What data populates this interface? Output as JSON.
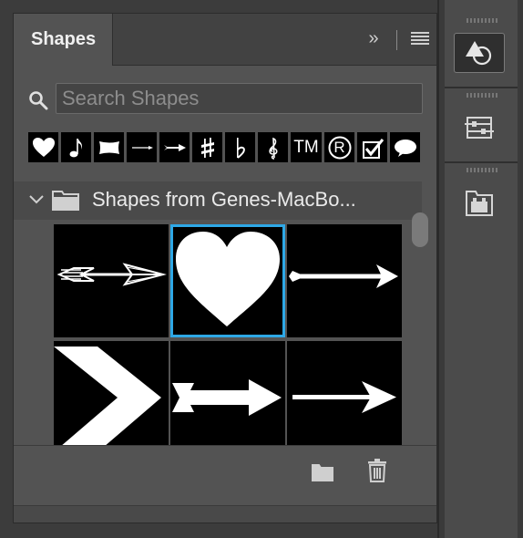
{
  "panel": {
    "tab_label": "Shapes",
    "collapse_glyph": "»",
    "search": {
      "placeholder": "Search Shapes",
      "value": ""
    },
    "recent_shapes": [
      {
        "name": "heart"
      },
      {
        "name": "eighth-note"
      },
      {
        "name": "banner"
      },
      {
        "name": "thin-arrow"
      },
      {
        "name": "tailed-arrow"
      },
      {
        "name": "sharp"
      },
      {
        "name": "flat"
      },
      {
        "name": "treble-clef"
      },
      {
        "name": "trademark",
        "text": "TM"
      },
      {
        "name": "registered",
        "text": "R"
      },
      {
        "name": "checkbox"
      },
      {
        "name": "speech-bubble"
      }
    ],
    "group": {
      "title": "Shapes from Genes-MacBo..."
    },
    "shapes_grid": [
      {
        "name": "feathered-arrow",
        "selected": false
      },
      {
        "name": "heart",
        "selected": true
      },
      {
        "name": "dart-arrow",
        "selected": false
      },
      {
        "name": "chevron",
        "selected": false
      },
      {
        "name": "block-arrow",
        "selected": false
      },
      {
        "name": "line-arrow",
        "selected": false
      }
    ],
    "footer": {
      "icons": [
        "new-group-folder-icon",
        "trash-icon"
      ]
    }
  },
  "dock": {
    "icons": [
      "shapes-panel-icon",
      "properties-icon",
      "libraries-icon"
    ]
  },
  "colors": {
    "selection": "#2ea8e6",
    "panel": "#535353",
    "dark": "#3c3c3c"
  }
}
